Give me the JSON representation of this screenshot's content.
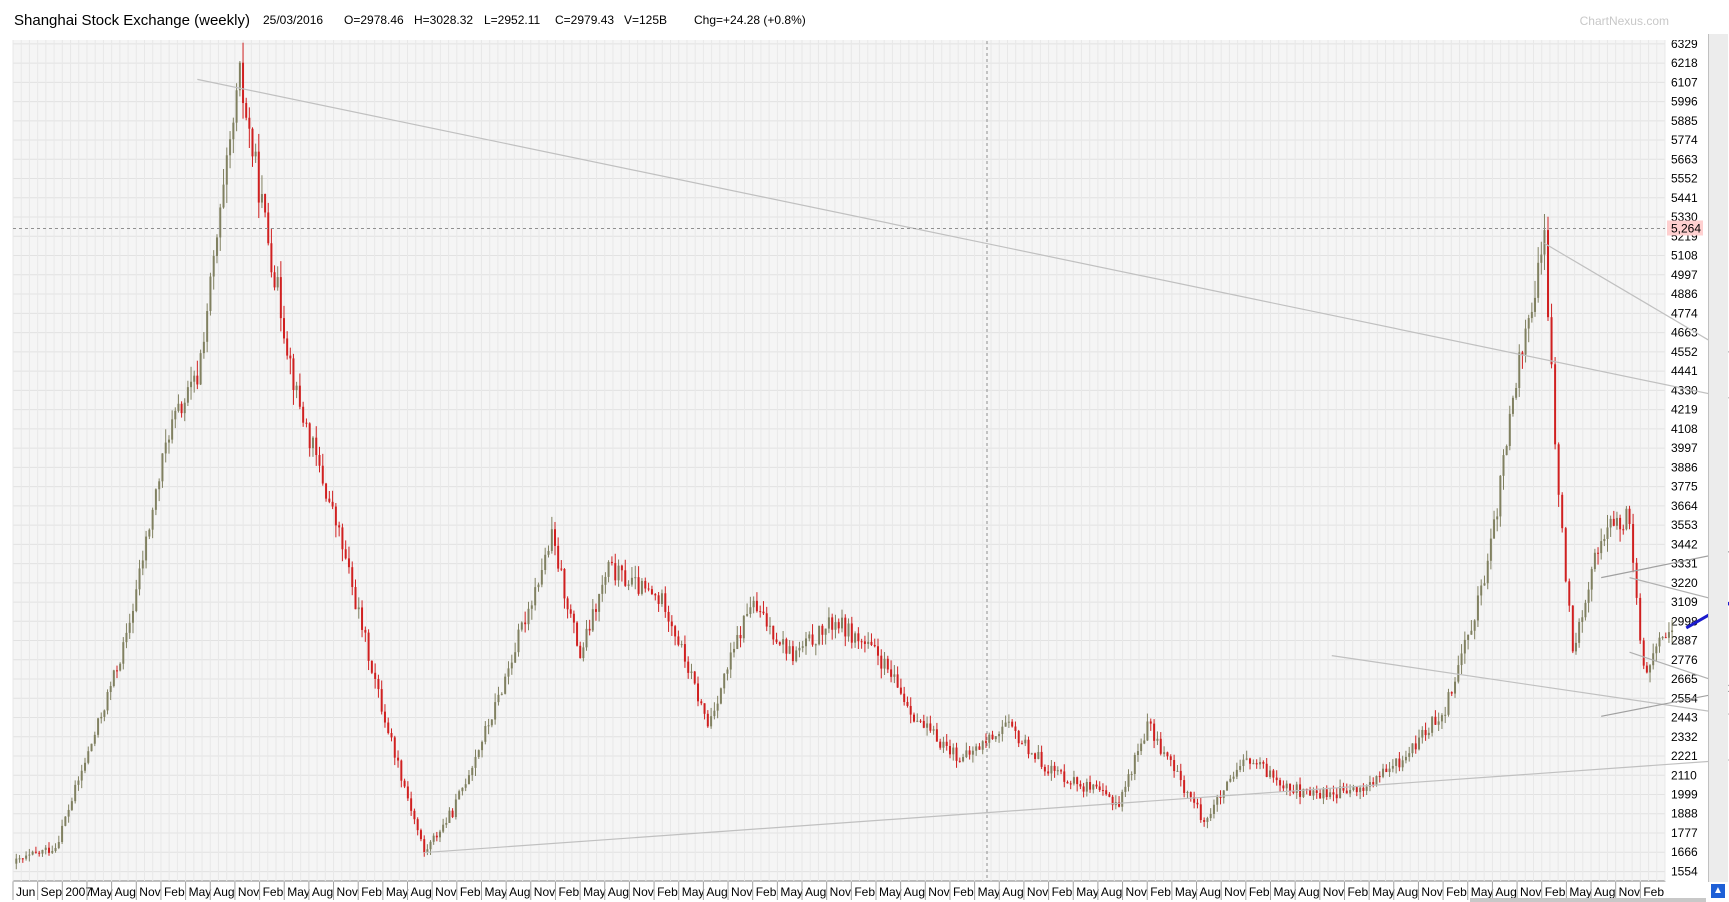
{
  "header": {
    "title": "Shanghai Stock Exchange (weekly)",
    "date": "25/03/2016",
    "open": "O=2978.46",
    "high": "H=3028.32",
    "low": "L=2952.11",
    "close": "C=2979.43",
    "volume": "V=125B",
    "change": "Chg=+24.28 (+0.8%)",
    "brand": "ChartNexus.com"
  },
  "colors": {
    "up_candle": "#808060",
    "down_candle": "#d02020",
    "trendline": "#c0c0c0",
    "projection": "#1a1acc",
    "crosshair_label_bg": "#ffd0d0",
    "crosshair_label_text": "#c00000"
  },
  "chart_data": {
    "type": "candlestick",
    "title": "Shanghai Stock Exchange (weekly)",
    "y_ticks": [
      6329,
      6218,
      6107,
      5996,
      5885,
      5774,
      5663,
      5552,
      5441,
      5330,
      5219,
      5108,
      4997,
      4886,
      4774,
      4663,
      4552,
      4441,
      4330,
      4219,
      4108,
      3997,
      3886,
      3775,
      3664,
      3553,
      3442,
      3331,
      3220,
      3109,
      2998,
      2887,
      2776,
      2665,
      2554,
      2443,
      2332,
      2221,
      2110,
      1999,
      1888,
      1777,
      1666,
      1554
    ],
    "ylim": [
      1500,
      6380
    ],
    "crosshair_value": "5,264",
    "x_ticks": [
      "Jun",
      "Sep",
      "2007",
      "May",
      "Aug",
      "Nov",
      "Feb",
      "May",
      "Aug",
      "Nov",
      "Feb",
      "May",
      "Aug",
      "Nov",
      "Feb",
      "May",
      "Aug",
      "Nov",
      "Feb",
      "May",
      "Aug",
      "Nov",
      "Feb",
      "May",
      "Aug",
      "Nov",
      "Feb",
      "May",
      "Aug",
      "Nov",
      "Feb",
      "May",
      "Aug",
      "Nov",
      "Feb",
      "May",
      "Aug",
      "Nov",
      "Feb",
      "May",
      "Aug",
      "Nov",
      "Feb",
      "May",
      "Aug",
      "Nov",
      "Feb",
      "May",
      "Aug",
      "Nov",
      "Feb",
      "May",
      "Aug",
      "Nov",
      "Feb",
      "May",
      "Aug",
      "Nov",
      "Feb",
      "May",
      "Aug",
      "Nov",
      "Feb",
      "May",
      "Aug",
      "Nov",
      "Feb"
    ],
    "x_range": [
      "2006-06",
      "2016-02"
    ],
    "price_path": [
      {
        "date": "2006-06",
        "value": 1600
      },
      {
        "date": "2006-09",
        "value": 1700
      },
      {
        "date": "2006-12",
        "value": 2400
      },
      {
        "date": "2007-02",
        "value": 2900
      },
      {
        "date": "2007-05",
        "value": 4100
      },
      {
        "date": "2007-07",
        "value": 4400
      },
      {
        "date": "2007-10",
        "value": 6124
      },
      {
        "date": "2007-12",
        "value": 5200
      },
      {
        "date": "2008-02",
        "value": 4300
      },
      {
        "date": "2008-05",
        "value": 3500
      },
      {
        "date": "2008-08",
        "value": 2500
      },
      {
        "date": "2008-11",
        "value": 1664
      },
      {
        "date": "2009-01",
        "value": 1900
      },
      {
        "date": "2009-04",
        "value": 2500
      },
      {
        "date": "2009-08",
        "value": 3478
      },
      {
        "date": "2009-10",
        "value": 2800
      },
      {
        "date": "2009-12",
        "value": 3300
      },
      {
        "date": "2010-04",
        "value": 3100
      },
      {
        "date": "2010-07",
        "value": 2400
      },
      {
        "date": "2010-10",
        "value": 3100
      },
      {
        "date": "2011-01",
        "value": 2800
      },
      {
        "date": "2011-04",
        "value": 3000
      },
      {
        "date": "2011-07",
        "value": 2800
      },
      {
        "date": "2011-10",
        "value": 2400
      },
      {
        "date": "2012-01",
        "value": 2200
      },
      {
        "date": "2012-04",
        "value": 2400
      },
      {
        "date": "2012-07",
        "value": 2150
      },
      {
        "date": "2012-12",
        "value": 1950
      },
      {
        "date": "2013-02",
        "value": 2400
      },
      {
        "date": "2013-06",
        "value": 1849
      },
      {
        "date": "2013-09",
        "value": 2200
      },
      {
        "date": "2014-01",
        "value": 2000
      },
      {
        "date": "2014-05",
        "value": 2020
      },
      {
        "date": "2014-08",
        "value": 2200
      },
      {
        "date": "2014-11",
        "value": 2500
      },
      {
        "date": "2015-02",
        "value": 3300
      },
      {
        "date": "2015-04",
        "value": 4400
      },
      {
        "date": "2015-06",
        "value": 5178
      },
      {
        "date": "2015-07",
        "value": 3700
      },
      {
        "date": "2015-08",
        "value": 2850
      },
      {
        "date": "2015-10",
        "value": 3500
      },
      {
        "date": "2015-12",
        "value": 3600
      },
      {
        "date": "2016-01",
        "value": 2700
      },
      {
        "date": "2016-03",
        "value": 2979
      }
    ],
    "annotations": "grey trendlines and blue projected zig-zag path"
  }
}
